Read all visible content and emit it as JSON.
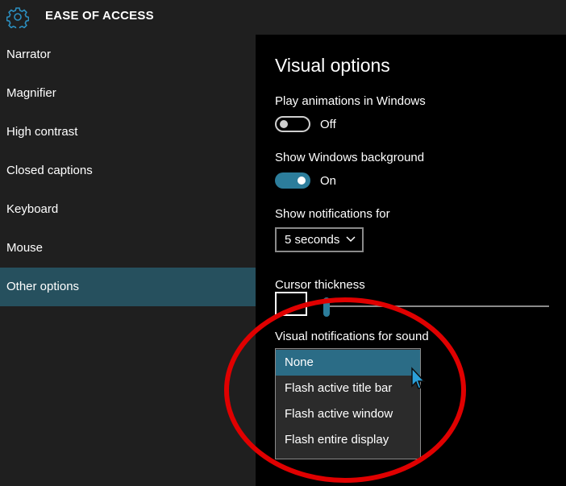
{
  "app": {
    "title": "EASE OF ACCESS",
    "icon": "gear-icon"
  },
  "sidebar": {
    "items": [
      {
        "label": "Narrator",
        "selected": false
      },
      {
        "label": "Magnifier",
        "selected": false
      },
      {
        "label": "High contrast",
        "selected": false
      },
      {
        "label": "Closed captions",
        "selected": false
      },
      {
        "label": "Keyboard",
        "selected": false
      },
      {
        "label": "Mouse",
        "selected": false
      },
      {
        "label": "Other options",
        "selected": true
      }
    ]
  },
  "main": {
    "title": "Visual options",
    "animations": {
      "label": "Play animations in Windows",
      "state": "Off"
    },
    "background": {
      "label": "Show Windows background",
      "state": "On"
    },
    "notifications": {
      "label": "Show notifications for",
      "value": "5 seconds"
    },
    "cursor": {
      "label": "Cursor thickness"
    },
    "sound": {
      "label": "Visual notifications for sound",
      "options": [
        "None",
        "Flash active title bar",
        "Flash active window",
        "Flash entire display"
      ],
      "selected": "None"
    }
  },
  "colors": {
    "accent": "#2c7d9b",
    "selected_nav": "#26505e",
    "annotation": "#e00000"
  }
}
